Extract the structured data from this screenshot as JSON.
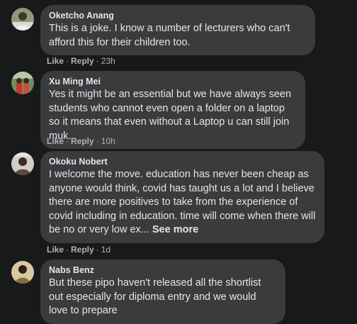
{
  "comments": [
    {
      "author": "Oketcho Anang",
      "text": "This is a joke. I know a number of lecturers who can't afford this for their children too.",
      "like_label": "Like",
      "reply_label": "Reply",
      "time": "23h"
    },
    {
      "author": "Xu Ming Mei",
      "text": "Yes it might be an essential but we have always seen students who cannot even open a folder on a laptop so it means that even without a Laptop u can still join muk.",
      "like_label": "Like",
      "reply_label": "Reply",
      "time": "10h"
    },
    {
      "author": "Okoku Nobert",
      "text": "I welcome the move. education has never been cheap as anyone would think, covid has taught us a lot and I believe there are more positives to take from the experience of covid including in education. time will come when there will be no or very low ex...",
      "see_more_label": "See more",
      "like_label": "Like",
      "reply_label": "Reply",
      "time": "1d"
    },
    {
      "author": "Nabs Benz",
      "text": "But these pipo haven't released all the shortlist out especially for diploma entry and we would love to prepare"
    }
  ],
  "separators": {
    "dot": "·"
  },
  "colors": {
    "background": "#18191a",
    "bubble": "#3a3b3c",
    "primary_text": "#e4e6eb",
    "secondary_text": "#b0b3b8"
  }
}
